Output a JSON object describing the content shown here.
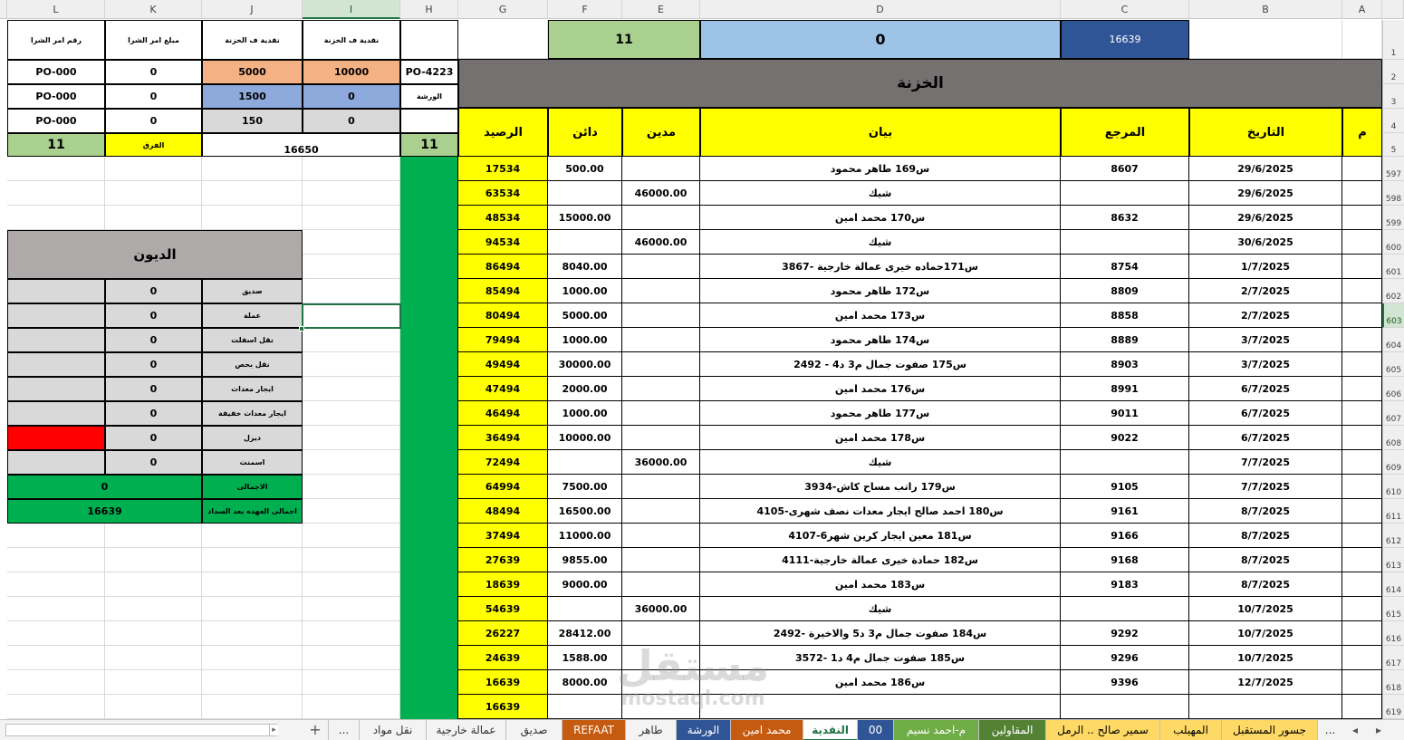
{
  "app": {
    "name": "Excel",
    "active_sheet": "النقدية",
    "selected_cell": "I603"
  },
  "column_headers": [
    {
      "letter": "L"
    },
    {
      "letter": "K"
    },
    {
      "letter": "J"
    },
    {
      "letter": "I"
    },
    {
      "letter": "H"
    },
    {
      "letter": "G"
    },
    {
      "letter": "F"
    },
    {
      "letter": "E"
    },
    {
      "letter": "D"
    },
    {
      "letter": "C"
    },
    {
      "letter": "B"
    },
    {
      "letter": "A"
    }
  ],
  "top_summary": {
    "c_value": "16639",
    "d_value": "0",
    "f_value": "11",
    "title": "الخزنة"
  },
  "ledger_headers": {
    "m": "م",
    "date": "التاريخ",
    "ref": "المرجع",
    "desc": "بيان",
    "debit": "مدين",
    "credit": "دائن",
    "balance": "الرصيد"
  },
  "ledger_rows": [
    {
      "row": "597",
      "date": "29/6/2025",
      "ref": "8607",
      "desc": "س169 طاهر محمود",
      "debit": "",
      "credit": "500.00",
      "balance": "17534"
    },
    {
      "row": "598",
      "date": "29/6/2025",
      "ref": "",
      "desc": "شيك",
      "debit": "46000.00",
      "credit": "",
      "balance": "63534"
    },
    {
      "row": "599",
      "date": "29/6/2025",
      "ref": "8632",
      "desc": "س170 محمد امين",
      "debit": "",
      "credit": "15000.00",
      "balance": "48534"
    },
    {
      "row": "600",
      "date": "30/6/2025",
      "ref": "",
      "desc": "شيك",
      "debit": "46000.00",
      "credit": "",
      "balance": "94534"
    },
    {
      "row": "601",
      "date": "1/7/2025",
      "ref": "8754",
      "desc": "س171حماده خيرى عمالة خارجية -3867",
      "debit": "",
      "credit": "8040.00",
      "balance": "86494"
    },
    {
      "row": "602",
      "date": "2/7/2025",
      "ref": "8809",
      "desc": "س172 طاهر محمود",
      "debit": "",
      "credit": "1000.00",
      "balance": "85494"
    },
    {
      "row": "603",
      "date": "2/7/2025",
      "ref": "8858",
      "desc": "س173 محمد امين",
      "debit": "",
      "credit": "5000.00",
      "balance": "80494"
    },
    {
      "row": "604",
      "date": "3/7/2025",
      "ref": "8889",
      "desc": "س174 طاهر محمود",
      "debit": "",
      "credit": "1000.00",
      "balance": "79494"
    },
    {
      "row": "605",
      "date": "3/7/2025",
      "ref": "8903",
      "desc": "س175 صفوت جمال م3 د4 - 2492",
      "debit": "",
      "credit": "30000.00",
      "balance": "49494"
    },
    {
      "row": "606",
      "date": "6/7/2025",
      "ref": "8991",
      "desc": "س176 محمد امين",
      "debit": "",
      "credit": "2000.00",
      "balance": "47494"
    },
    {
      "row": "607",
      "date": "6/7/2025",
      "ref": "9011",
      "desc": "س177 طاهر محمود",
      "debit": "",
      "credit": "1000.00",
      "balance": "46494"
    },
    {
      "row": "608",
      "date": "6/7/2025",
      "ref": "9022",
      "desc": "س178 محمد امين",
      "debit": "",
      "credit": "10000.00",
      "balance": "36494"
    },
    {
      "row": "609",
      "date": "7/7/2025",
      "ref": "",
      "desc": "شيك",
      "debit": "36000.00",
      "credit": "",
      "balance": "72494"
    },
    {
      "row": "610",
      "date": "7/7/2025",
      "ref": "9105",
      "desc": "س179 راتب مساح كاش-3934",
      "debit": "",
      "credit": "7500.00",
      "balance": "64994"
    },
    {
      "row": "611",
      "date": "8/7/2025",
      "ref": "9161",
      "desc": "س180 احمد صالح ايجار معدات نصف شهرى-4105",
      "debit": "",
      "credit": "16500.00",
      "balance": "48494"
    },
    {
      "row": "612",
      "date": "8/7/2025",
      "ref": "9166",
      "desc": "س181 معين ايجار كرين شهر6-4107",
      "debit": "",
      "credit": "11000.00",
      "balance": "37494"
    },
    {
      "row": "613",
      "date": "8/7/2025",
      "ref": "9168",
      "desc": "س182 حمادة خيرى عمالة خارجية-4111",
      "debit": "",
      "credit": "9855.00",
      "balance": "27639"
    },
    {
      "row": "614",
      "date": "8/7/2025",
      "ref": "9183",
      "desc": "س183 محمد امين",
      "debit": "",
      "credit": "9000.00",
      "balance": "18639"
    },
    {
      "row": "615",
      "date": "10/7/2025",
      "ref": "",
      "desc": "شيك",
      "debit": "36000.00",
      "credit": "",
      "balance": "54639"
    },
    {
      "row": "616",
      "date": "10/7/2025",
      "ref": "9292",
      "desc": "س184 صفوت جمال م3 د5 والاخيرة -2492",
      "debit": "",
      "credit": "28412.00",
      "balance": "26227"
    },
    {
      "row": "617",
      "date": "10/7/2025",
      "ref": "9296",
      "desc": "س185 صفوت جمال م4 د1 -3572",
      "debit": "",
      "credit": "1588.00",
      "balance": "24639"
    },
    {
      "row": "618",
      "date": "12/7/2025",
      "ref": "9396",
      "desc": "س186 محمد امين",
      "debit": "",
      "credit": "8000.00",
      "balance": "16639"
    },
    {
      "row": "619",
      "date": "",
      "ref": "",
      "desc": "",
      "debit": "",
      "credit": "",
      "balance": "16639"
    }
  ],
  "header_rows": [
    "1",
    "2",
    "3",
    "4",
    "5"
  ],
  "left_header": {
    "l": "رقم امر الشرا",
    "k": "مبلغ امر الشرا",
    "j": "نقدية ف الخزنة",
    "i": "نقدية ف الخزنة"
  },
  "left_rows": [
    {
      "l": "PO-000",
      "k": "0",
      "j": "5000",
      "i": "10000",
      "h": "PO-4223"
    },
    {
      "l": "PO-000",
      "k": "0",
      "j": "1500",
      "i": "0",
      "h": "الورشة"
    },
    {
      "l": "PO-000",
      "k": "0",
      "j": "150",
      "i": "0",
      "h": ""
    }
  ],
  "left_summary": {
    "l_val": "11",
    "k_label": "الفرق",
    "ji_val": "16650",
    "h_val": "11"
  },
  "debts": {
    "title": "الديون",
    "rows": [
      {
        "label": "صديق",
        "value": "0"
      },
      {
        "label": "عملة",
        "value": "0"
      },
      {
        "label": "نقل اسفلت",
        "value": "0"
      },
      {
        "label": "نقل بحص",
        "value": "0"
      },
      {
        "label": "ايجار معدات",
        "value": "0"
      },
      {
        "label": "ايجار معدات خفيفة",
        "value": "0"
      },
      {
        "label": "ديزل",
        "value": "0"
      },
      {
        "label": "اسمنت",
        "value": "0"
      }
    ],
    "total_label": "الاجمالى",
    "total_value": "0",
    "grand_label": "اجمالى العهده بعد السداد",
    "grand_value": "16639"
  },
  "sheet_tabs": [
    {
      "label": "..."
    },
    {
      "label": "جسور المستقبل"
    },
    {
      "label": "المهيلب"
    },
    {
      "label": "سمير صالح .. الرمل"
    },
    {
      "label": "المقاولين"
    },
    {
      "label": "م-احمد نسيم"
    },
    {
      "label": "00"
    },
    {
      "label": "النقدية"
    },
    {
      "label": "محمد امين"
    },
    {
      "label": "الورشة"
    },
    {
      "label": "طاهر"
    },
    {
      "label": "REFAAT"
    },
    {
      "label": "صديق"
    },
    {
      "label": "عمالة خارجية"
    },
    {
      "label": "نقل مواد"
    },
    {
      "label": "..."
    }
  ],
  "add_sheet_label": "+",
  "watermark": {
    "line1": "مستقل",
    "line2": "mostaql.com"
  },
  "colors": {
    "yellow": "#ffff00",
    "green": "#00b050",
    "header_gray": "#767171",
    "navy": "#2f5597",
    "light_blue": "#9dc3e6",
    "light_green": "#a9d08e",
    "orange": "#f4b183",
    "periwinkle": "#8ea9db",
    "red": "#ff0000",
    "excel_green": "#217346"
  }
}
